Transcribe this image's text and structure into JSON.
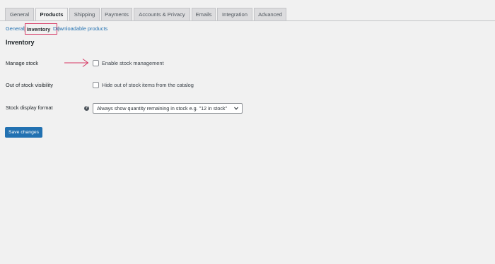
{
  "tabs": [
    {
      "label": "General"
    },
    {
      "label": "Products"
    },
    {
      "label": "Shipping"
    },
    {
      "label": "Payments"
    },
    {
      "label": "Accounts & Privacy"
    },
    {
      "label": "Emails"
    },
    {
      "label": "Integration"
    },
    {
      "label": "Advanced"
    }
  ],
  "active_tab": "Products",
  "subnav": {
    "items": [
      {
        "label": "General"
      },
      {
        "label": "Inventory"
      },
      {
        "label": "Downloadable products"
      }
    ],
    "separators": [
      "|",
      "|"
    ],
    "current": "Inventory"
  },
  "section": {
    "title": "Inventory"
  },
  "settings": {
    "manage_stock": {
      "label": "Manage stock",
      "checkbox_label": "Enable stock management",
      "checked": false
    },
    "out_of_stock_visibility": {
      "label": "Out of stock visibility",
      "checkbox_label": "Hide out of stock items from the catalog",
      "checked": false
    },
    "stock_display_format": {
      "label": "Stock display format",
      "help_icon": "?",
      "selected": "Always show quantity remaining in stock e.g. \"12 in stock\""
    }
  },
  "save_button": {
    "label": "Save changes"
  },
  "colors": {
    "accent": "#2271b1",
    "highlight": "#d63864",
    "background": "#f1f1f1"
  },
  "icons": {
    "help": "help-icon",
    "dropdown": "chevron-down-icon",
    "annotation": "arrow-right-icon"
  }
}
